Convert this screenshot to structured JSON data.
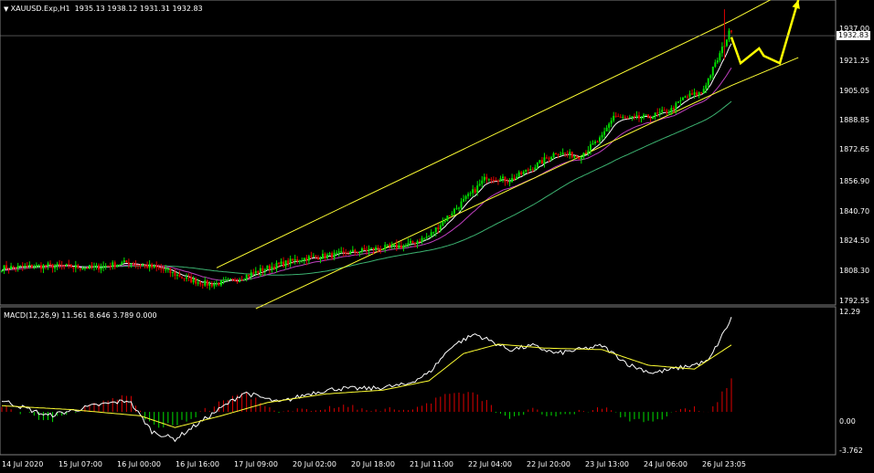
{
  "header": {
    "symbol": "XAUUSD.Exp,H1",
    "ohlc": "1935.13 1938.12 1931.31 1932.83"
  },
  "macd_header": "MACD(12,26,9) 11.561 8.646 3.789 0.000",
  "price_axis": {
    "ticks": [
      "1937.00",
      "1921.25",
      "1905.05",
      "1888.85",
      "1872.65",
      "1856.90",
      "1840.70",
      "1824.50",
      "1808.30",
      "1792.55"
    ],
    "current": "1932.83",
    "current_color": "#ffffff"
  },
  "macd_axis": {
    "ticks": [
      "12.29",
      "0.00",
      "-3.762"
    ]
  },
  "time_axis": {
    "labels": [
      "14 Jul 2020",
      "15 Jul 07:00",
      "16 Jul 00:00",
      "16 Jul 16:00",
      "17 Jul 09:00",
      "20 Jul 02:00",
      "20 Jul 18:00",
      "21 Jul 11:00",
      "22 Jul 04:00",
      "22 Jul 20:00",
      "23 Jul 13:00",
      "24 Jul 06:00",
      "26 Jul 23:05"
    ]
  },
  "colors": {
    "bull": "#00e000",
    "bear": "#e00000",
    "channel": "#ffff33",
    "ma_fast": "#ffffff",
    "ma_mid": "#c040c0",
    "ma_slow": "#3cb371",
    "signal": "#ffff33",
    "arrow": "#ffff00"
  },
  "chart_data": {
    "type": "candlestick",
    "symbol": "XAUUSD.Exp",
    "timeframe": "H1",
    "ylim": [
      1788,
      1952
    ],
    "anchors": [
      [
        0,
        1808
      ],
      [
        20,
        1809
      ],
      [
        40,
        1808
      ],
      [
        55,
        1811
      ],
      [
        70,
        1807
      ],
      [
        80,
        1802
      ],
      [
        90,
        1799
      ],
      [
        100,
        1801
      ],
      [
        115,
        1808
      ],
      [
        130,
        1813
      ],
      [
        145,
        1815
      ],
      [
        160,
        1818
      ],
      [
        175,
        1820
      ],
      [
        185,
        1825
      ],
      [
        195,
        1838
      ],
      [
        205,
        1850
      ],
      [
        210,
        1857
      ],
      [
        220,
        1855
      ],
      [
        230,
        1862
      ],
      [
        240,
        1870
      ],
      [
        250,
        1868
      ],
      [
        260,
        1878
      ],
      [
        265,
        1890
      ],
      [
        270,
        1888
      ],
      [
        280,
        1889
      ],
      [
        290,
        1893
      ],
      [
        296,
        1900
      ],
      [
        303,
        1902
      ],
      [
        310,
        1920
      ],
      [
        316,
        1937
      ]
    ],
    "macd_ylim": [
      -5.5,
      13.5
    ],
    "macd_anchors": [
      [
        0,
        1.5
      ],
      [
        20,
        -0.5
      ],
      [
        40,
        0.8
      ],
      [
        55,
        1.5
      ],
      [
        65,
        -2.5
      ],
      [
        75,
        -3.5
      ],
      [
        90,
        -0.5
      ],
      [
        105,
        2.5
      ],
      [
        120,
        1.2
      ],
      [
        135,
        2.5
      ],
      [
        145,
        3.0
      ],
      [
        160,
        3.0
      ],
      [
        175,
        3.5
      ],
      [
        185,
        5.0
      ],
      [
        195,
        8.5
      ],
      [
        205,
        10.0
      ],
      [
        220,
        8.0
      ],
      [
        230,
        8.5
      ],
      [
        240,
        7.5
      ],
      [
        250,
        8.0
      ],
      [
        260,
        8.5
      ],
      [
        272,
        6.0
      ],
      [
        282,
        5.0
      ],
      [
        296,
        5.8
      ],
      [
        306,
        6.5
      ],
      [
        316,
        12.0
      ]
    ],
    "signal_anchors": [
      [
        0,
        0.8
      ],
      [
        30,
        0.3
      ],
      [
        60,
        -0.5
      ],
      [
        75,
        -2.0
      ],
      [
        95,
        -0.5
      ],
      [
        115,
        1.2
      ],
      [
        140,
        2.3
      ],
      [
        165,
        2.8
      ],
      [
        185,
        4.0
      ],
      [
        200,
        7.5
      ],
      [
        215,
        8.7
      ],
      [
        235,
        8.2
      ],
      [
        260,
        8.0
      ],
      [
        280,
        6.0
      ],
      [
        300,
        5.5
      ],
      [
        316,
        8.6
      ]
    ],
    "channel_upper": [
      [
        93,
        1808
      ],
      [
        316,
        1941
      ],
      [
        345,
        1960
      ]
    ],
    "channel_lower": [
      [
        110,
        1786
      ],
      [
        316,
        1906
      ],
      [
        345,
        1921
      ]
    ],
    "forecast": [
      [
        316,
        1932
      ],
      [
        320,
        1918
      ],
      [
        328,
        1926
      ],
      [
        330,
        1922
      ],
      [
        337,
        1918
      ],
      [
        345,
        1952
      ]
    ]
  }
}
